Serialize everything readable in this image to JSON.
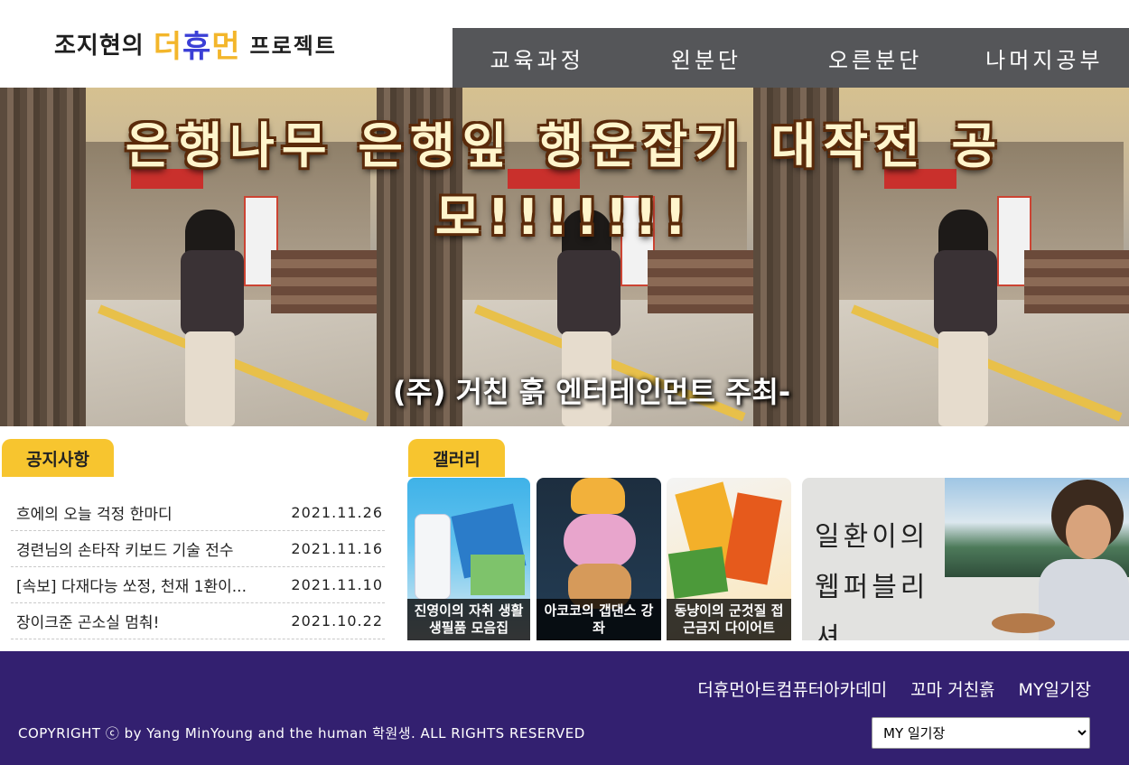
{
  "header": {
    "logo": {
      "part1": "조지현의",
      "part2a": "더",
      "part2b": "휴",
      "part2c": "먼",
      "part3": "프로젝트"
    },
    "nav": [
      "교육과정",
      "왼분단",
      "오른분단",
      "나머지공부"
    ]
  },
  "banner": {
    "title": "은행나무 은행잎 행운잡기 대작전 공모!!!!!!!",
    "subtitle": "(주) 거친 흙 엔터테인먼트 주최-"
  },
  "notice": {
    "tab_label": "공지사항",
    "items": [
      {
        "title": "흐에의 오늘 걱정 한마디",
        "date": "2021.11.26"
      },
      {
        "title": "경련님의 손타작 키보드 기술 전수",
        "date": "2021.11.16"
      },
      {
        "title": "[속보] 다재다능 쏘정, 천재 1환이...",
        "date": "2021.11.10"
      },
      {
        "title": "장이크준 곤소실 멈춰!",
        "date": "2021.10.22"
      }
    ]
  },
  "gallery": {
    "tab_label": "갤러리",
    "items": [
      {
        "caption": "진영이의 자취 생활 생필품 모음집"
      },
      {
        "caption": "아코코의 갭댄스 강좌"
      },
      {
        "caption": "동냥이의 군것질 접근금지 다이어트"
      },
      {
        "caption": "일환이의 웹퍼블리셔"
      }
    ]
  },
  "footer": {
    "links": [
      "더휴먼아트컴퓨터아카데미",
      "꼬마 거친흙",
      "MY일기장"
    ],
    "copyright": "COPYRIGHT ⓒ by Yang MinYoung and the human 학원생. ALL RIGHTS RESERVED",
    "select": {
      "selected": "MY 일기장"
    }
  },
  "colors": {
    "nav_bg": "#555659",
    "tab_accent": "#f7c52f",
    "footer_bg": "#332070"
  }
}
